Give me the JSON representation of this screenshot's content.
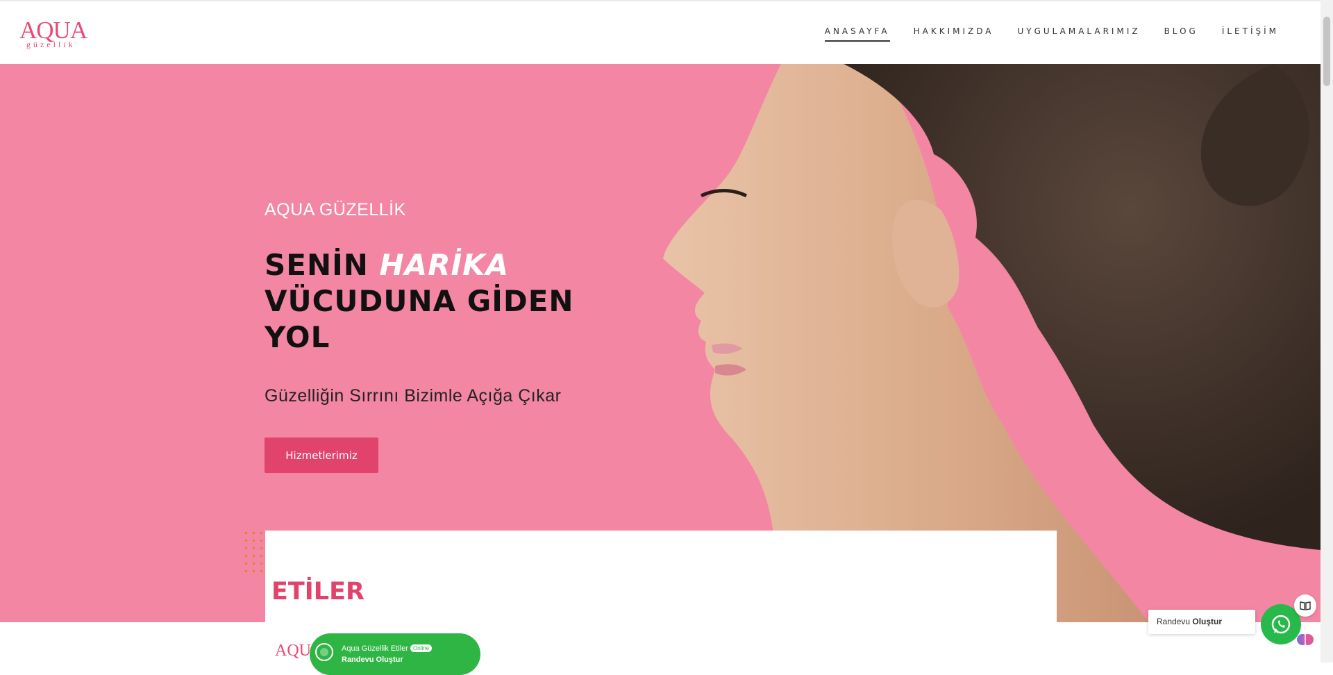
{
  "logo": {
    "main": "AQUA",
    "sub": "güzellik"
  },
  "nav": {
    "items": [
      {
        "label": "ANASAYFA",
        "active": true
      },
      {
        "label": "HAKKIMIZDA",
        "active": false
      },
      {
        "label": "UYGULAMALARIMIZ",
        "active": false
      },
      {
        "label": "BLOG",
        "active": false
      },
      {
        "label": "İLETİŞİM",
        "active": false
      }
    ]
  },
  "hero": {
    "eyebrow": "AQUA GÜZELLİK",
    "headline_start": "SENİN ",
    "headline_highlight": "HARİKA",
    "headline_end": " VÜCUDUNA GİDEN YOL",
    "tagline": "Güzelliğin Sırrını Bizimle Açığa Çıkar",
    "cta_label": "Hizmetlerimiz"
  },
  "section": {
    "title": "ETİLER",
    "mini_logo": "AQUA"
  },
  "whatsapp_bar": {
    "name": "Aqua Güzellik Etiler",
    "status": "Online",
    "action": "Randevu Oluştur"
  },
  "widget": {
    "label_prefix": "Randevu ",
    "label_bold": "Oluştur"
  },
  "colors": {
    "hero_bg": "#f387a3",
    "brand_pink": "#e1436c",
    "whatsapp_green": "#2fb543"
  },
  "icons": [
    "whatsapp-icon",
    "book-reader-icon",
    "brain-icon"
  ]
}
